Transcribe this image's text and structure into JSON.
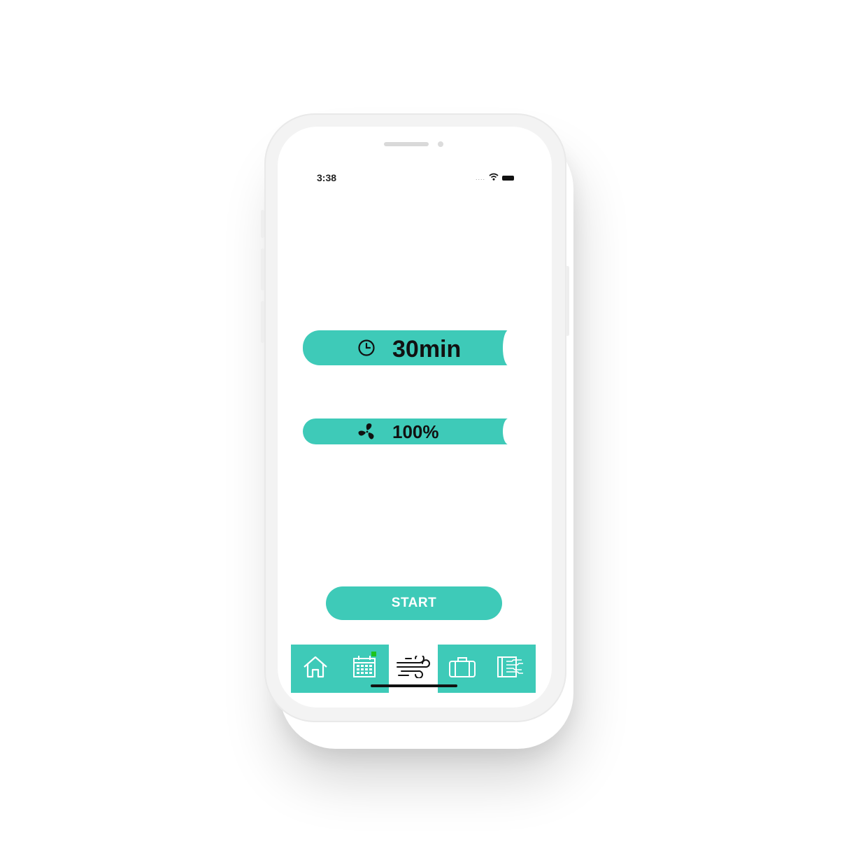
{
  "status_bar": {
    "time": "3:38",
    "signal": "....",
    "icons": [
      "wifi-icon",
      "battery-icon"
    ]
  },
  "controls": {
    "timer": {
      "value": "30min",
      "icon": "clock-icon"
    },
    "fan": {
      "value": "100%",
      "icon": "fan-icon"
    }
  },
  "start_button": {
    "label": "START"
  },
  "tab_bar": {
    "tabs": [
      {
        "icon": "home-icon",
        "active": false
      },
      {
        "icon": "calendar-icon",
        "active": false,
        "badge": true
      },
      {
        "icon": "wind-icon",
        "active": true
      },
      {
        "icon": "suitcase-icon",
        "active": false
      },
      {
        "icon": "settings-panel-icon",
        "active": false
      }
    ]
  },
  "colors": {
    "accent": "#3ecab8",
    "badge": "#1ec31e",
    "text": "#111111"
  }
}
